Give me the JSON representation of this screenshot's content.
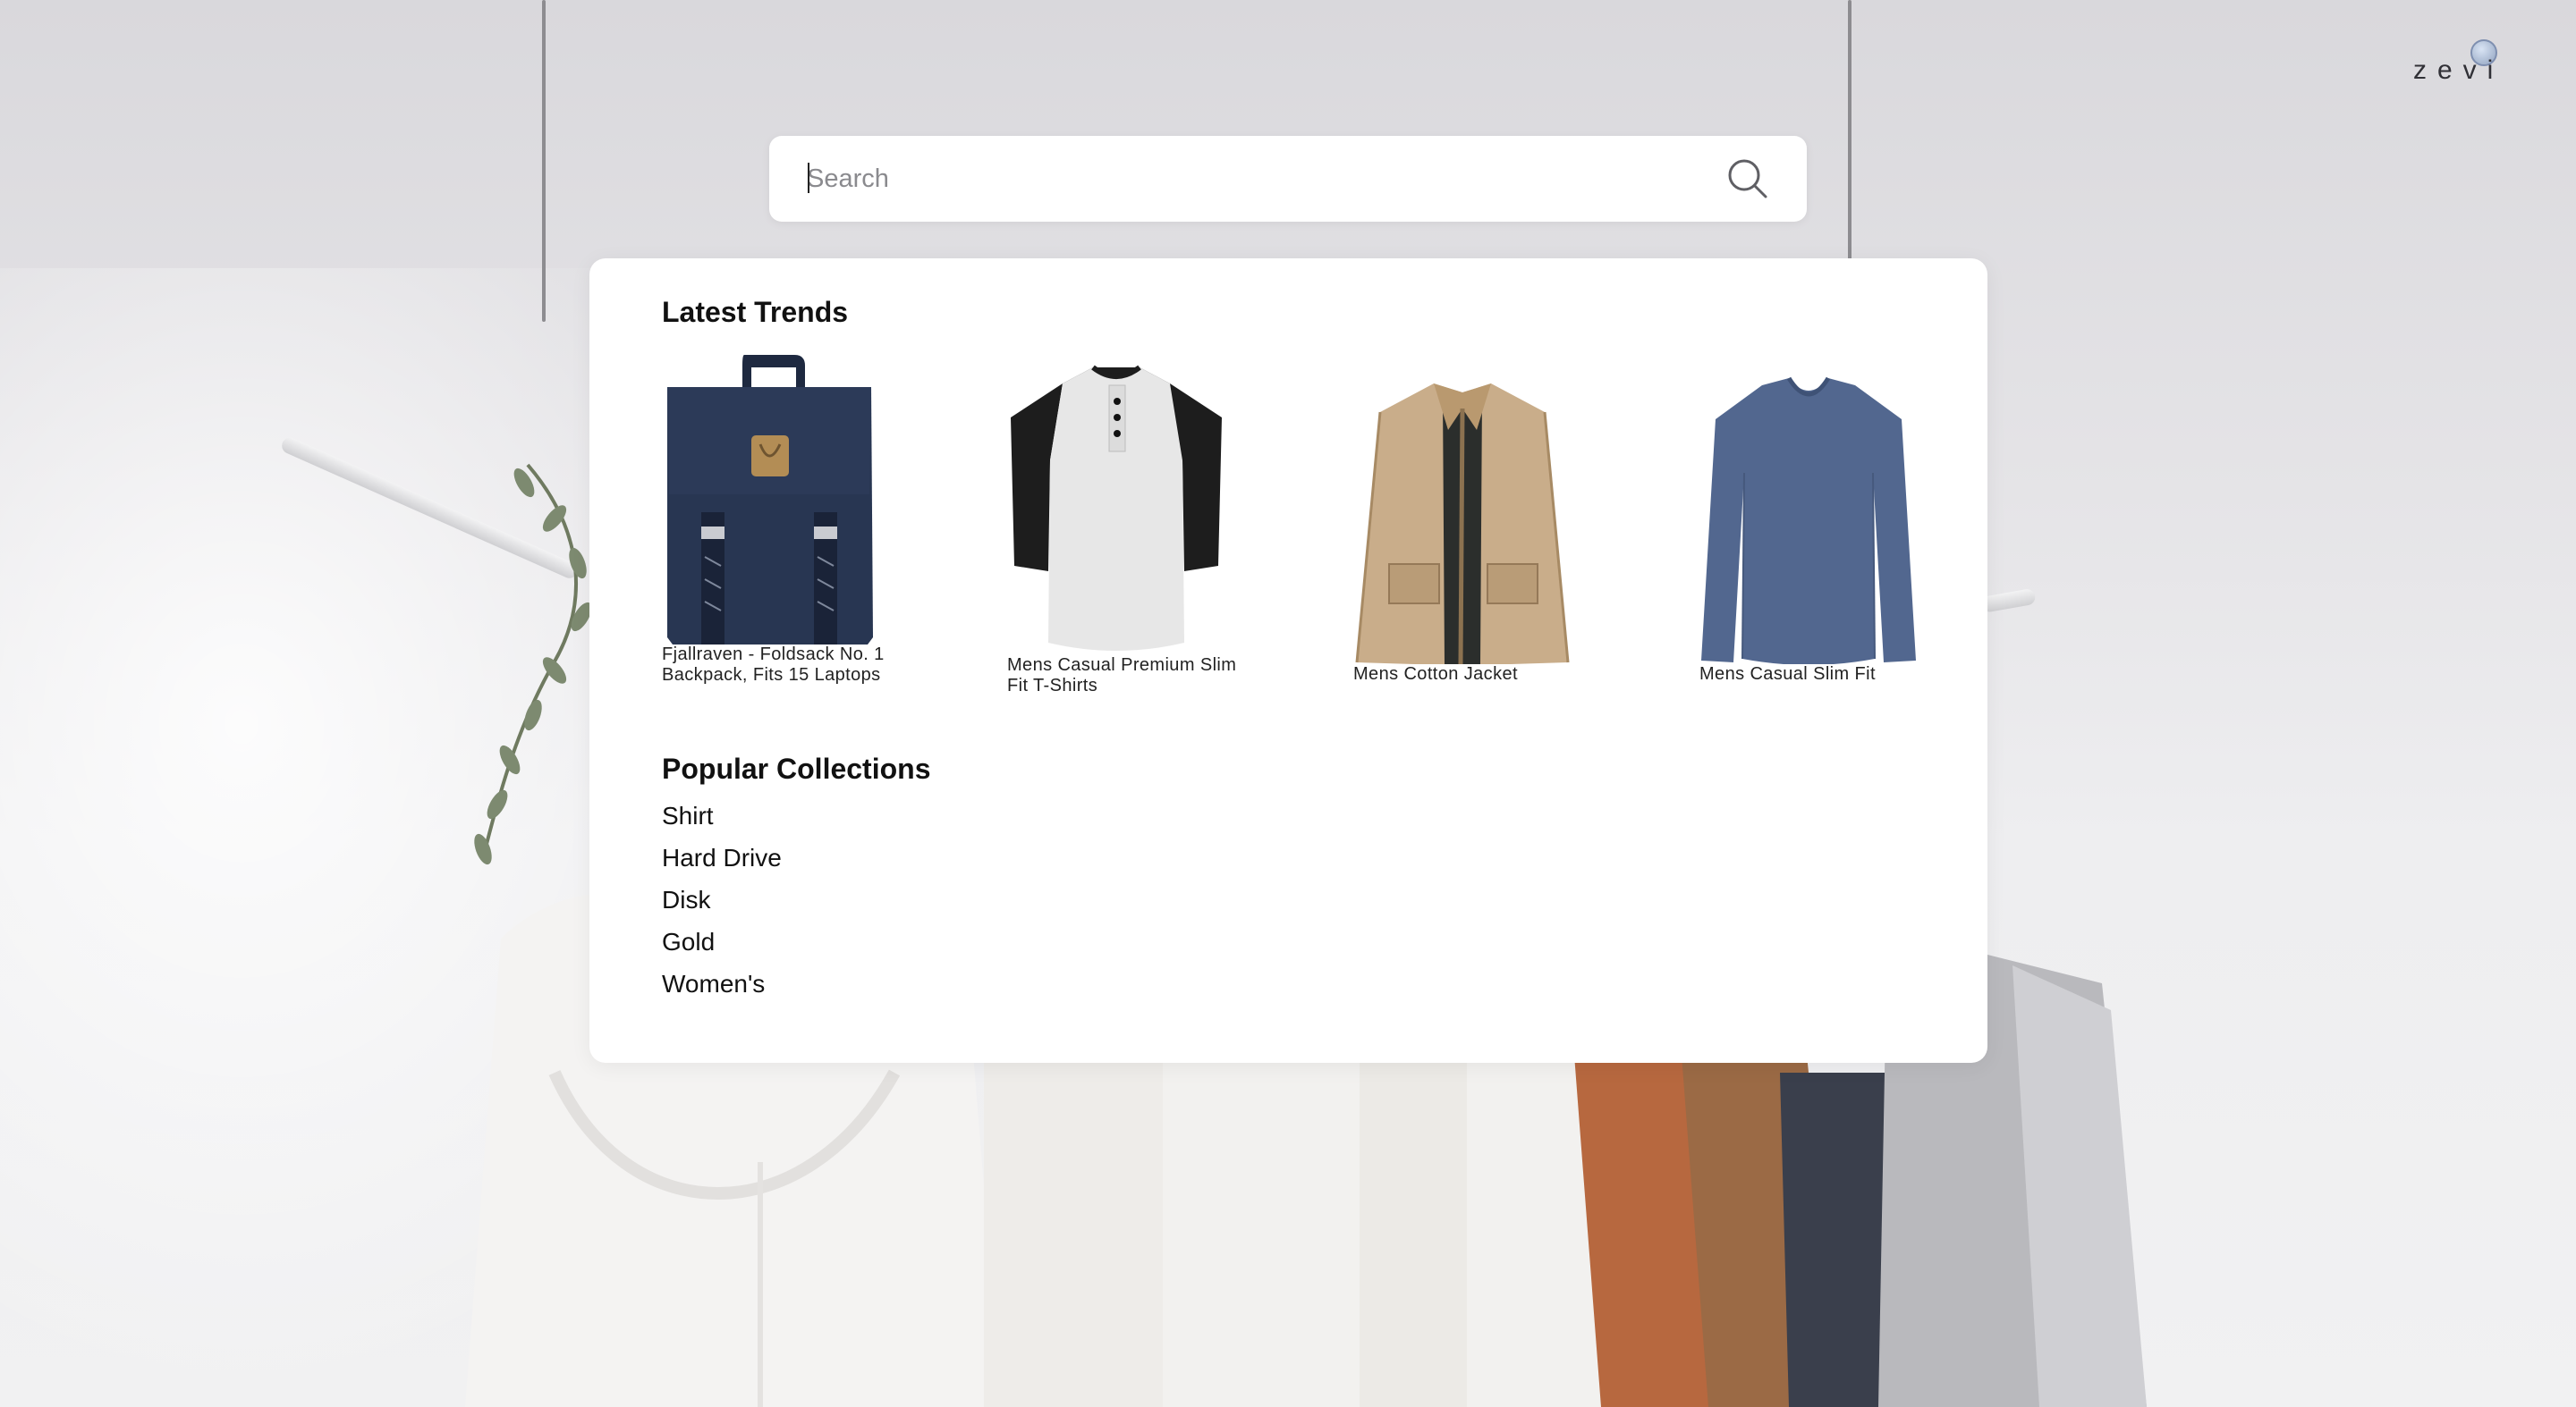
{
  "brand": {
    "logo_text": "zevi"
  },
  "search": {
    "placeholder": "Search",
    "value": ""
  },
  "latest_trends": {
    "title": "Latest Trends",
    "items": [
      {
        "name": "Fjallraven - Foldsack No. 1 Backpack, Fits 15 Laptops",
        "image": "navy-backpack"
      },
      {
        "name": "Mens Casual Premium Slim Fit T-Shirts",
        "image": "raglan-henley-shirt"
      },
      {
        "name": "Mens Cotton Jacket",
        "image": "khaki-jacket"
      },
      {
        "name": "Mens Casual Slim Fit",
        "image": "blue-long-sleeve-tee"
      }
    ]
  },
  "popular_collections": {
    "title": "Popular Collections",
    "items": [
      "Shirt",
      "Hard Drive",
      "Disk",
      "Gold",
      "Women's"
    ]
  },
  "colors": {
    "panel": "#ffffff",
    "text": "#111111",
    "backpack": "#283652",
    "jacket": "#c9ad8a",
    "slim_tee": "#52678f"
  }
}
